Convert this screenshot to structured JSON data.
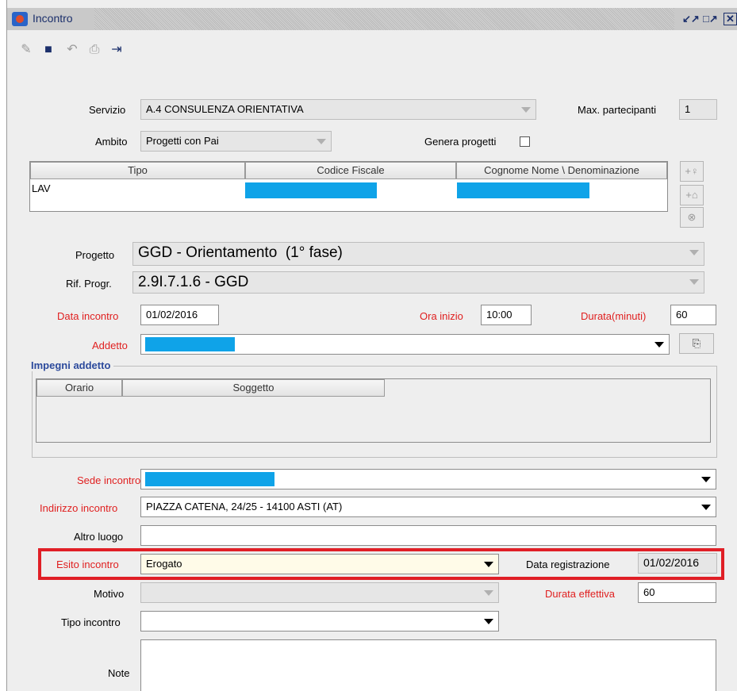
{
  "window": {
    "title": "Incontro"
  },
  "title_buttons": {
    "restore": "↗",
    "maximize": "↗",
    "close": "✕"
  },
  "form": {
    "servizio": {
      "label": "Servizio",
      "value": "A.4 CONSULENZA ORIENTATIVA"
    },
    "max_partecipanti": {
      "label": "Max. partecipanti",
      "value": "1"
    },
    "ambito": {
      "label": "Ambito",
      "value": "Progetti con Pai"
    },
    "genera_progetti": {
      "label": "Genera progetti",
      "checked": false
    },
    "participants_table": {
      "columns": [
        "Tipo",
        "Codice Fiscale",
        "Cognome Nome \\ Denominazione"
      ],
      "rows": [
        {
          "tipo": "LAV",
          "codice_fiscale": "",
          "nome": ""
        }
      ]
    },
    "progetto": {
      "label": "Progetto",
      "value": "GGD - Orientamento  (1° fase)"
    },
    "rif_progr": {
      "label": "Rif. Progr.",
      "value": "2.9I.7.1.6 - GGD"
    },
    "data_incontro": {
      "label": "Data incontro",
      "value": "01/02/2016"
    },
    "ora_inizio": {
      "label": "Ora inizio",
      "value": "10:00"
    },
    "durata": {
      "label": "Durata(minuti)",
      "value": "60"
    },
    "addetto": {
      "label": "Addetto",
      "value": ""
    },
    "impegni": {
      "legend": "Impegni addetto",
      "columns": [
        "Orario",
        "Soggetto"
      ]
    },
    "sede_incontro": {
      "label": "Sede incontro",
      "value": ""
    },
    "indirizzo_incontro": {
      "label": "Indirizzo incontro",
      "value": "PIAZZA CATENA, 24/25 - 14100 ASTI (AT)"
    },
    "altro_luogo": {
      "label": "Altro luogo",
      "value": ""
    },
    "esito_incontro": {
      "label": "Esito incontro",
      "value": "Erogato"
    },
    "data_registrazione": {
      "label": "Data registrazione",
      "value": "01/02/2016"
    },
    "motivo": {
      "label": "Motivo",
      "value": ""
    },
    "durata_effettiva": {
      "label": "Durata effettiva",
      "value": "60"
    },
    "tipo_incontro": {
      "label": "Tipo incontro",
      "value": ""
    },
    "note": {
      "label": "Note",
      "value": ""
    }
  },
  "colors": {
    "required_label": "#e02020",
    "redacted": "#0fa3e8",
    "highlight": "#e01f26",
    "section_legend": "#2c4a9c"
  }
}
